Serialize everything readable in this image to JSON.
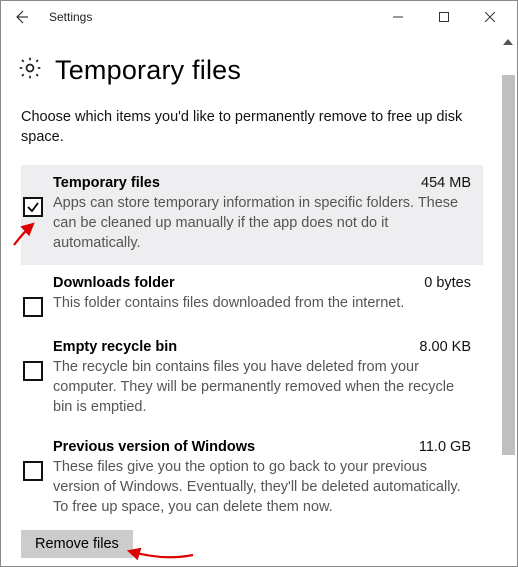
{
  "window": {
    "title": "Settings"
  },
  "page": {
    "title": "Temporary files",
    "intro": "Choose which items you'd like to permanently remove to free up disk space."
  },
  "items": [
    {
      "title": "Temporary files",
      "size": "454 MB",
      "desc": "Apps can store temporary information in specific folders. These can be cleaned up manually if the app does not do it automatically.",
      "checked": true,
      "selected": true
    },
    {
      "title": "Downloads folder",
      "size": "0 bytes",
      "desc": "This folder contains files downloaded from the internet.",
      "checked": false,
      "selected": false
    },
    {
      "title": "Empty recycle bin",
      "size": "8.00 KB",
      "desc": "The recycle bin contains files you have deleted from your computer. They will be permanently removed when the recycle bin is emptied.",
      "checked": false,
      "selected": false
    },
    {
      "title": "Previous version of Windows",
      "size": "11.0 GB",
      "desc": "These files give you the option to go back to your previous version of Windows. Eventually, they'll be deleted automatically. To free up space, you can delete them now.",
      "checked": false,
      "selected": false
    }
  ],
  "remove_label": "Remove files"
}
